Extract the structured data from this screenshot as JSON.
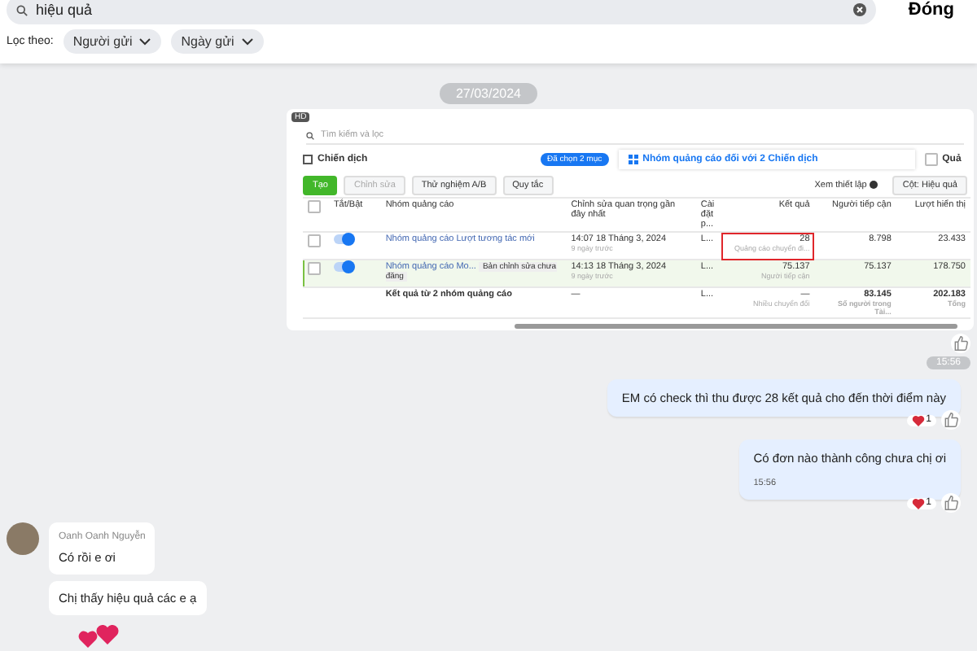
{
  "search": {
    "value": "hiệu quả"
  },
  "close_button": "Đóng",
  "filter": {
    "label": "Lọc theo:",
    "chips": [
      "Người gửi",
      "Ngày gửi"
    ]
  },
  "date_divider": "27/03/2024",
  "shared_screenshot": {
    "hd_badge": "HD",
    "search_placeholder": "Tìm kiếm và lọc",
    "campaigns_tab": "Chiến dịch",
    "selection_chip": "Đã chọn 2 mục",
    "adsets_tab": "Nhóm quảng cáo đối với 2 Chiến dịch",
    "third_tab": "Quả",
    "toolbar": [
      {
        "kind": "primary",
        "label": "Tạo"
      },
      {
        "kind": "disabled",
        "label": "Chỉnh sửa"
      },
      {
        "kind": "normal",
        "label": "Thử nghiệm A/B"
      },
      {
        "kind": "normal",
        "label": "Quy tắc"
      },
      {
        "kind": "toggle",
        "label": "Xem thiết lập"
      },
      {
        "kind": "normal",
        "label": "Cột: Hiệu quả"
      }
    ],
    "columns": [
      "Tắt/Bật",
      "Nhóm quảng cáo",
      "Chỉnh sửa quan trọng gần đây nhất",
      "Cài đặt p...",
      "Kết quả",
      "Người tiếp cận",
      "Lượt hiển thị"
    ],
    "rows": [
      {
        "on": true,
        "selected": false,
        "name": "Nhóm quảng cáo Lượt tương tác mới",
        "edit": "14:07 18 Tháng 3, 2024",
        "edit_note": "9 ngày trước",
        "setting": "L...",
        "result": "28",
        "result_note": "Quảng cáo chuyển đi...",
        "result_marked": true,
        "reach": "8.798",
        "impressions": "23.433"
      },
      {
        "on": true,
        "selected": true,
        "name": "Nhóm quảng cáo Mo...",
        "tag": "Bản chỉnh sửa chưa đăng",
        "edit": "14:13 18 Tháng 3, 2024",
        "edit_note": "9 ngày trước",
        "setting": "L...",
        "result": "75.137",
        "result_note": "Người tiếp cận",
        "result_marked": false,
        "reach": "75.137",
        "impressions": "178.750"
      }
    ],
    "total": {
      "label": "Kết quả từ 2 nhóm quảng cáo",
      "edit": "—",
      "setting": "L...",
      "result": "—",
      "result_note": "Nhiều chuyển đổi",
      "reach": "83.145",
      "reach_note": "Số người trong Tài...",
      "impressions": "202.183",
      "impressions_note": "Tổng"
    }
  },
  "time_divider": "15:56",
  "outgoing": [
    {
      "text": "EM có check thì thu được 28 kết quả cho đến thời điểm này",
      "reactions": "1"
    },
    {
      "text": "Có đơn nào thành công chưa chị ơi",
      "time": "15:56",
      "reactions": "1"
    }
  ],
  "incoming": {
    "sender": "Oanh Oanh Nguyễn",
    "messages": [
      "Có rồi e ơi",
      "Chị thấy hiệu quả các e ạ"
    ]
  }
}
